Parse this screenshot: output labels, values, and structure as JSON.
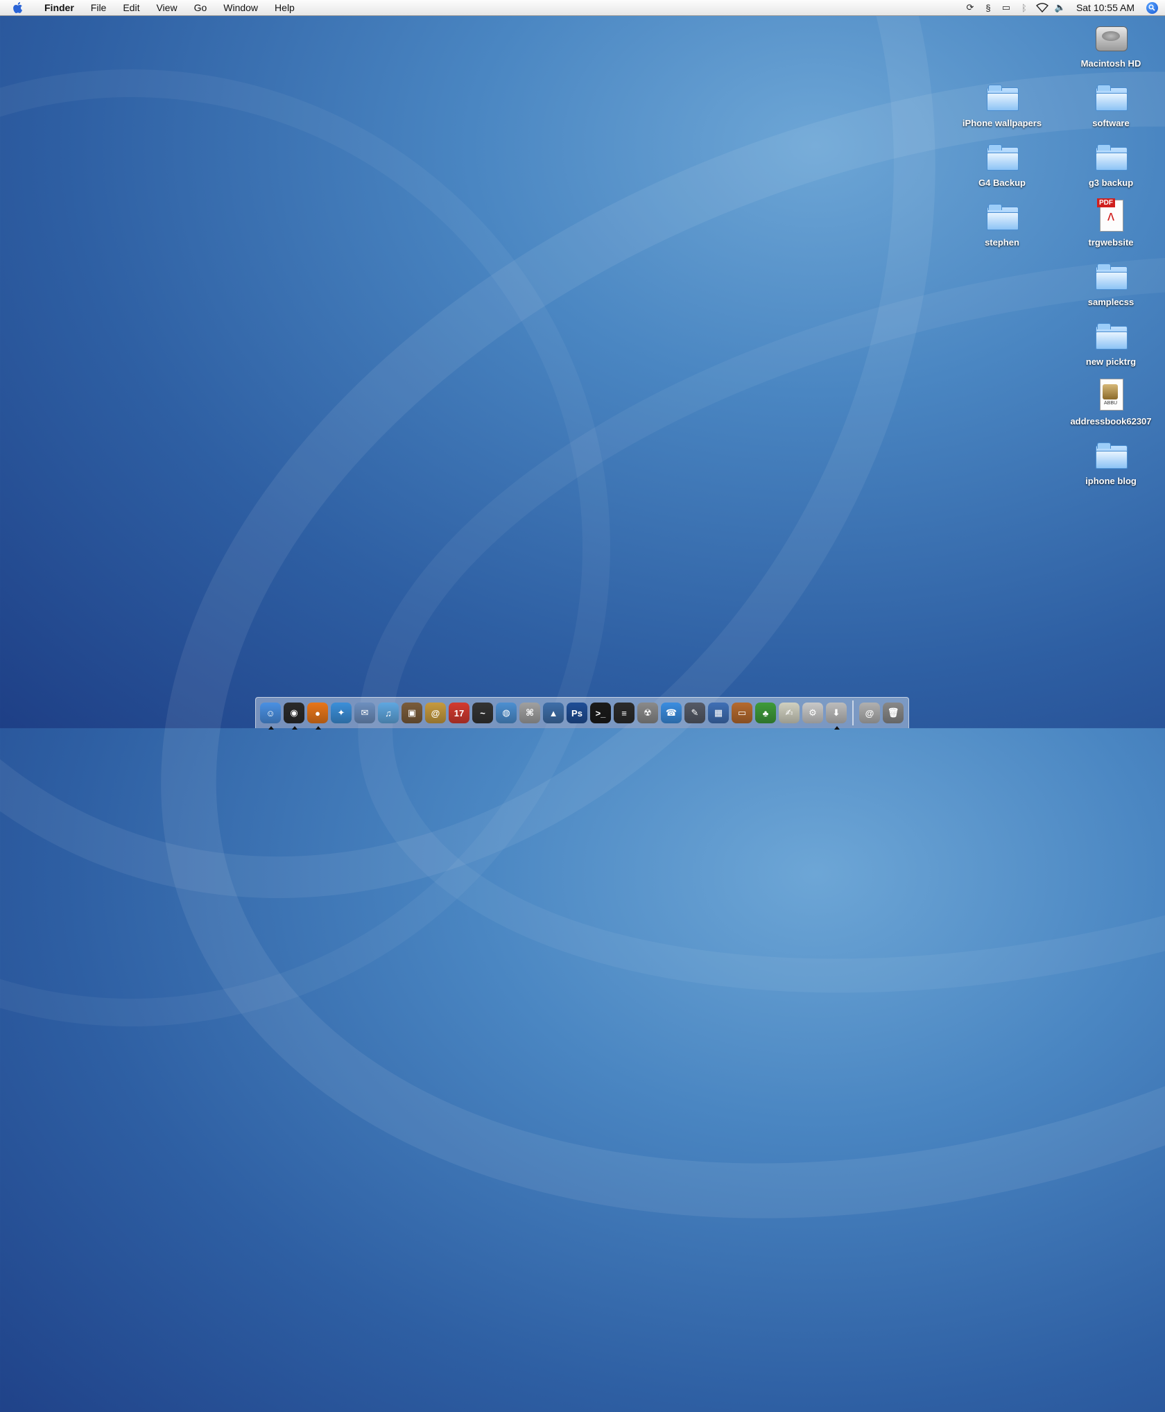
{
  "menubar": {
    "app_name": "Finder",
    "menus": [
      "File",
      "Edit",
      "View",
      "Go",
      "Window",
      "Help"
    ],
    "clock": "Sat 10:55 AM",
    "status_icons": [
      "sync-icon",
      "script-icon",
      "display-icon",
      "bluetooth-icon",
      "wifi-icon",
      "volume-icon"
    ]
  },
  "desktop": {
    "icons": [
      {
        "label": "Macintosh HD",
        "type": "hard-drive"
      },
      {
        "label": "iPhone wallpapers",
        "type": "folder"
      },
      {
        "label": "software",
        "type": "folder"
      },
      {
        "label": "G4 Backup",
        "type": "folder"
      },
      {
        "label": "g3 backup",
        "type": "folder"
      },
      {
        "label": "stephen",
        "type": "folder"
      },
      {
        "label": "trgwebsite",
        "type": "pdf"
      },
      {
        "label": "samplecss",
        "type": "folder"
      },
      {
        "label": "new picktrg",
        "type": "folder"
      },
      {
        "label": "addressbook62307",
        "type": "abbu"
      },
      {
        "label": "iphone blog",
        "type": "folder"
      }
    ],
    "pdf_tag": "PDF",
    "abbu_tag": "ABBU"
  },
  "dock": {
    "items": [
      {
        "name": "finder",
        "glyph": "☺",
        "color": "#4a90e2",
        "running": true
      },
      {
        "name": "dashboard",
        "glyph": "◉",
        "color": "#2a2a2a",
        "running": true
      },
      {
        "name": "firefox",
        "glyph": "●",
        "color": "#e8761a",
        "running": true
      },
      {
        "name": "safari",
        "glyph": "✦",
        "color": "#3b8fd9",
        "running": false
      },
      {
        "name": "mail",
        "glyph": "✉",
        "color": "#6d8fbf",
        "running": false
      },
      {
        "name": "itunes",
        "glyph": "♫",
        "color": "#5fa7e0",
        "running": false
      },
      {
        "name": "iphoto",
        "glyph": "▣",
        "color": "#7a5c3a",
        "running": false
      },
      {
        "name": "address-book",
        "glyph": "@",
        "color": "#c69a3e",
        "running": false
      },
      {
        "name": "ical",
        "glyph": "17",
        "color": "#d33a2f",
        "running": false
      },
      {
        "name": "activity-monitor",
        "glyph": "~",
        "color": "#333333",
        "running": false
      },
      {
        "name": "network",
        "glyph": "◍",
        "color": "#4c8fd1",
        "running": false
      },
      {
        "name": "preview",
        "glyph": "⌘",
        "color": "#a0a0a0",
        "running": false
      },
      {
        "name": "photo-browser",
        "glyph": "▲",
        "color": "#3e6ea8",
        "running": false
      },
      {
        "name": "photoshop",
        "glyph": "Ps",
        "color": "#1f4e96",
        "running": false
      },
      {
        "name": "terminal",
        "glyph": ">_",
        "color": "#1a1a1a",
        "running": false
      },
      {
        "name": "utility",
        "glyph": "≡",
        "color": "#2b2b2b",
        "running": false
      },
      {
        "name": "radiation",
        "glyph": "☢",
        "color": "#8a8a8a",
        "running": false
      },
      {
        "name": "ichat",
        "glyph": "☎",
        "color": "#3a8de0",
        "running": false
      },
      {
        "name": "script-editor",
        "glyph": "✎",
        "color": "#555a66",
        "running": false
      },
      {
        "name": "grapher",
        "glyph": "▦",
        "color": "#3f6fb5",
        "running": false
      },
      {
        "name": "keynote",
        "glyph": "▭",
        "color": "#b56a2e",
        "running": false
      },
      {
        "name": "adium",
        "glyph": "♣",
        "color": "#3e9b3a",
        "running": false
      },
      {
        "name": "textedit",
        "glyph": "✍",
        "color": "#d0d0c0",
        "running": false
      },
      {
        "name": "system-prefs",
        "glyph": "⚙",
        "color": "#c8c8c8",
        "running": false
      },
      {
        "name": "installer",
        "glyph": "⬇",
        "color": "#bcbcbc",
        "running": true
      }
    ],
    "right_items": [
      {
        "name": "mail-downloads",
        "glyph": "@",
        "color": "#b0b0b0"
      },
      {
        "name": "trash",
        "glyph": "🗑",
        "color": "#888888"
      }
    ]
  }
}
